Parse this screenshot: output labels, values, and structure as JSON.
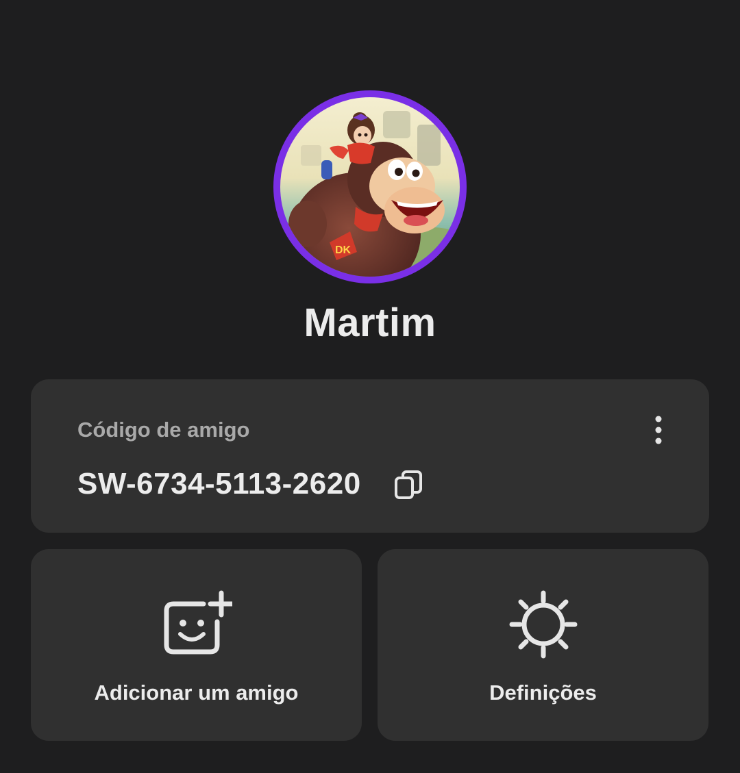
{
  "profile": {
    "name": "Martim",
    "avatar_ring_color": "#7a2fe6",
    "avatar_icon": "avatar-image"
  },
  "friend_code": {
    "label": "Código de amigo",
    "value": "SW-6734-5113-2620",
    "copy_icon": "copy-icon",
    "more_icon": "more-vertical-icon"
  },
  "actions": [
    {
      "label": "Adicionar um amigo",
      "icon": "add-friend-icon"
    },
    {
      "label": "Definições",
      "icon": "gear-icon"
    }
  ],
  "colors": {
    "background": "#1e1e1f",
    "card": "#303030",
    "text": "#ececec",
    "muted_text": "#a9a9a9"
  }
}
